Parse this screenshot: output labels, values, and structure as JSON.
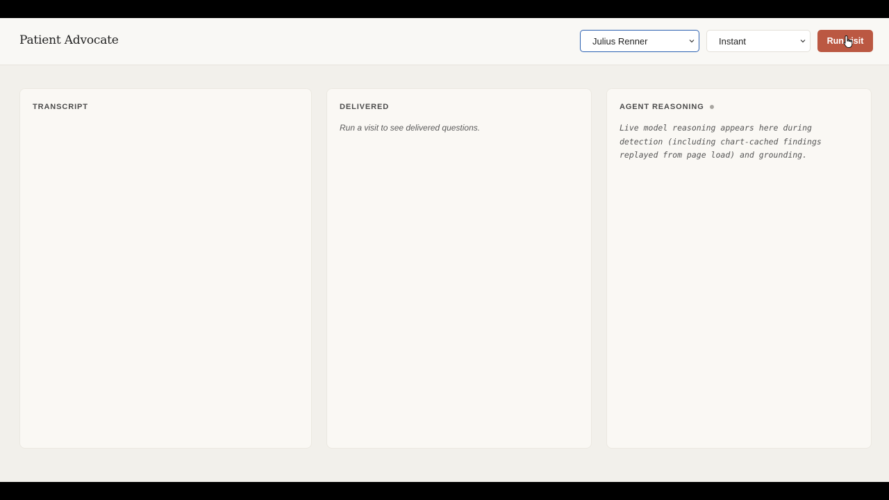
{
  "header": {
    "title": "Patient Advocate",
    "patient_select": {
      "value": "Julius Renner"
    },
    "mode_select": {
      "value": "Instant"
    },
    "run_button": "Run visit"
  },
  "panels": {
    "transcript": {
      "heading": "TRANSCRIPT"
    },
    "delivered": {
      "heading": "DELIVERED",
      "placeholder": "Run a visit to see delivered questions."
    },
    "reasoning": {
      "heading": "AGENT REASONING",
      "placeholder": "Live model reasoning appears here during detection (including chart-cached findings replayed from page load) and grounding."
    }
  },
  "colors": {
    "accent": "#bb5842",
    "focus_border": "#2a5fb0",
    "background": "#f2f0eb",
    "panel": "#faf8f4"
  },
  "icons": [
    "chevron-down-icon",
    "status-dot-icon",
    "pointer-cursor-icon"
  ]
}
